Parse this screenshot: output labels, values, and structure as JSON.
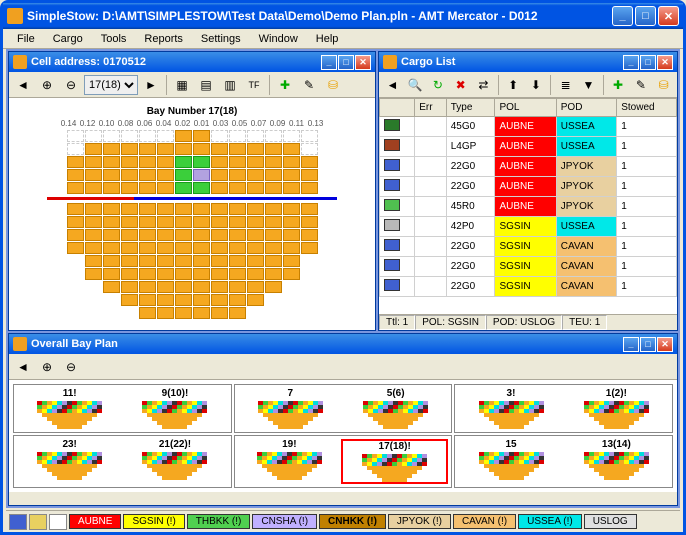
{
  "window": {
    "title": "SimpleStow: D:\\AMT\\SIMPLESTOW\\Test Data\\Demo\\Demo Plan.pln - AMT Mercator - D012"
  },
  "menu": [
    "File",
    "Cargo",
    "Tools",
    "Reports",
    "Settings",
    "Window",
    "Help"
  ],
  "cell_panel": {
    "title": "Cell address: 0170512",
    "bay_select": "17(18)",
    "bay_header": "Bay Number 17(18)",
    "slot_cols": [
      "0.14",
      "0.12",
      "0.10",
      "0.08",
      "0.06",
      "0.04",
      "0.02",
      "0.01",
      "0.03",
      "0.05",
      "0.07",
      "0.09",
      "0.11",
      "0.13"
    ]
  },
  "cargo_panel": {
    "title": "Cargo List",
    "headers": [
      "",
      "Err",
      "Type",
      "POL",
      "POD",
      "Stowed"
    ],
    "rows": [
      {
        "icn": "#2a7a2a",
        "type": "45G0",
        "pol": "AUBNE",
        "pod": "USSEA",
        "stw": "1"
      },
      {
        "icn": "#a04020",
        "type": "L4GP",
        "pol": "AUBNE",
        "pod": "USSEA",
        "stw": "1"
      },
      {
        "icn": "#4060d0",
        "type": "22G0",
        "pol": "AUBNE",
        "pod": "JPYOK",
        "stw": "1"
      },
      {
        "icn": "#4060d0",
        "type": "22G0",
        "pol": "AUBNE",
        "pod": "JPYOK",
        "stw": "1"
      },
      {
        "icn": "#50c050",
        "type": "45R0",
        "pol": "AUBNE",
        "pod": "JPYOK",
        "stw": "1"
      },
      {
        "icn": "#b8b8b8",
        "type": "42P0",
        "pol": "SGSIN",
        "pod": "USSEA",
        "stw": "1"
      },
      {
        "icn": "#4060d0",
        "type": "22G0",
        "pol": "SGSIN",
        "pod": "CAVAN",
        "stw": "1"
      },
      {
        "icn": "#4060d0",
        "type": "22G0",
        "pol": "SGSIN",
        "pod": "CAVAN",
        "stw": "1"
      },
      {
        "icn": "#4060d0",
        "type": "22G0",
        "pol": "SGSIN",
        "pod": "CAVAN",
        "stw": "1"
      }
    ],
    "status": {
      "ttl": "Ttl: 1",
      "pol": "POL: SGSIN",
      "pod": "POD: USLOG",
      "teu": "TEU: 1"
    }
  },
  "overall_panel": {
    "title": "Overall Bay Plan",
    "bays": [
      [
        {
          "lbl": "11!"
        },
        {
          "lbl": "9(10)!"
        }
      ],
      [
        {
          "lbl": "7"
        },
        {
          "lbl": "5(6)"
        }
      ],
      [
        {
          "lbl": "3!"
        },
        {
          "lbl": "1(2)!"
        }
      ],
      [
        {
          "lbl": "23!"
        },
        {
          "lbl": "21(22)!"
        }
      ],
      [
        {
          "lbl": "19!"
        },
        {
          "lbl": "17(18)!",
          "sel": true
        }
      ],
      [
        {
          "lbl": "15"
        },
        {
          "lbl": "13(14)"
        }
      ]
    ]
  },
  "ports": [
    {
      "code": "AUBNE",
      "cls": "chip-AUBNE"
    },
    {
      "code": "SGSIN (!)",
      "cls": "chip-SGSIN"
    },
    {
      "code": "THBKK (!)",
      "cls": "chip-THBKK"
    },
    {
      "code": "CNSHA (!)",
      "cls": "chip-CNSHA"
    },
    {
      "code": "CNHKK (!)",
      "cls": "chip-CNHKK"
    },
    {
      "code": "JPYOK (!)",
      "cls": "chip-JPYOK"
    },
    {
      "code": "CAVAN (!)",
      "cls": "chip-CAVAN"
    },
    {
      "code": "USSEA (!)",
      "cls": "chip-USSEA"
    },
    {
      "code": "USLOG",
      "cls": "chip-USLOG"
    }
  ]
}
